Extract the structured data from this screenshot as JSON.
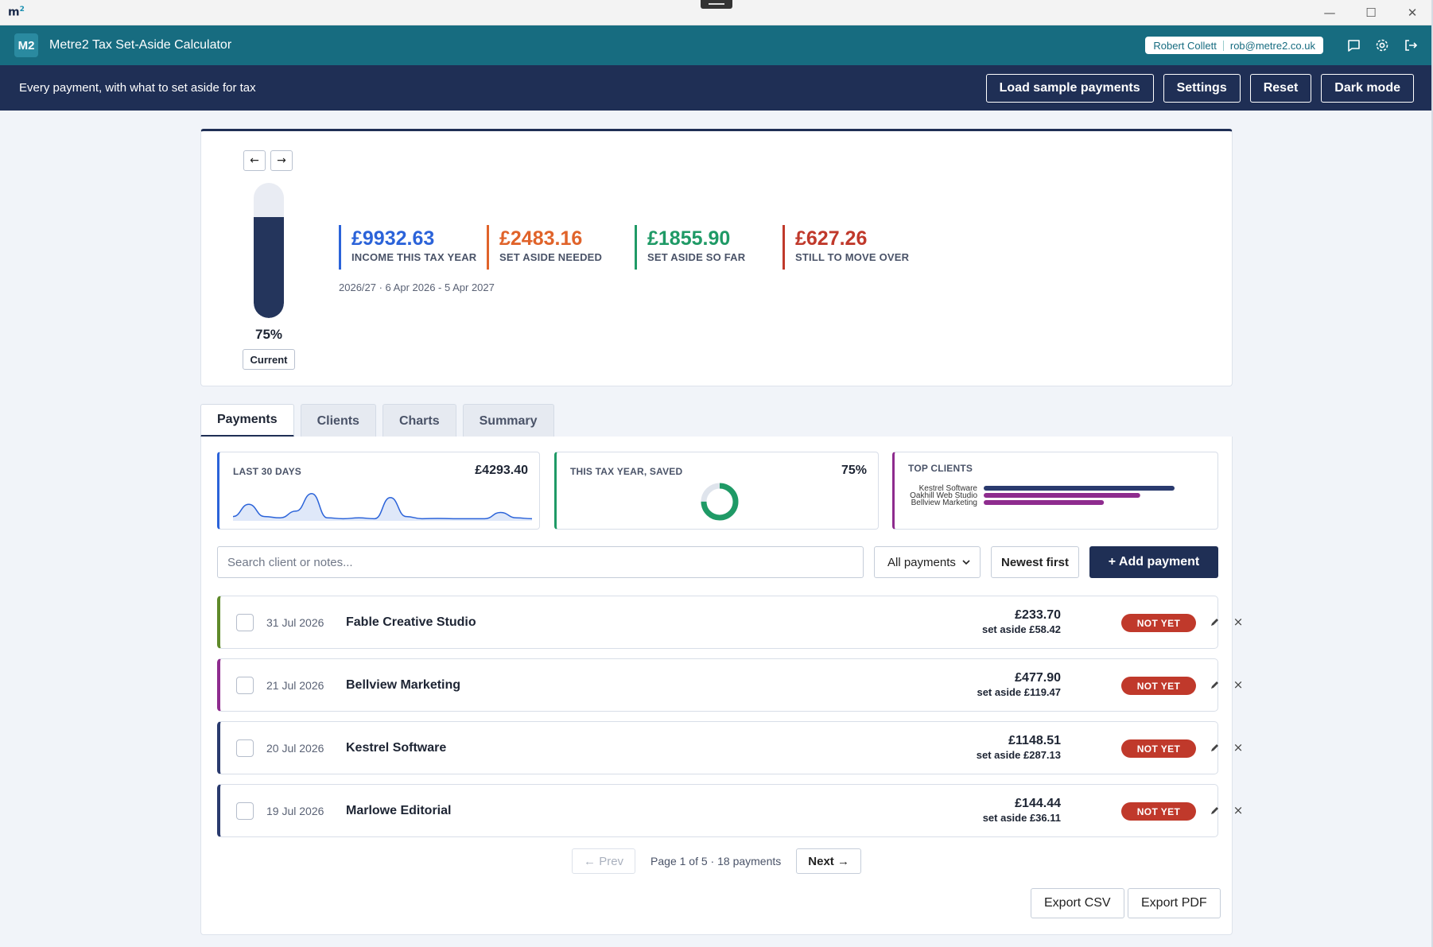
{
  "window": {
    "logo": "m",
    "logo_sup": "2"
  },
  "header": {
    "logo_text": "M2",
    "title": "Metre2 Tax Set-Aside Calculator",
    "user_name": "Robert Collett",
    "user_email": "rob@metre2.co.uk"
  },
  "subbar": {
    "tagline": "Every payment, with what to set aside for tax",
    "actions": [
      "Load sample payments",
      "Settings",
      "Reset",
      "Dark mode"
    ]
  },
  "hero": {
    "prev_arrow": "←",
    "next_arrow": "→",
    "gauge_fraction": 0.75,
    "gauge_pct": "75%",
    "gauge_label": "Current",
    "stats": [
      {
        "value": "£9932.63",
        "label": "INCOME THIS TAX YEAR",
        "color": "#2b63d9"
      },
      {
        "value": "£2483.16",
        "label": "SET ASIDE NEEDED",
        "color": "#e0632a"
      },
      {
        "value": "£1855.90",
        "label": "SET ASIDE SO FAR",
        "color": "#1f9a66"
      },
      {
        "value": "£627.26",
        "label": "STILL TO MOVE OVER",
        "color": "#c0392b"
      }
    ],
    "tax_year": "2026/27 · 6 Apr 2026 - 5 Apr 2027"
  },
  "tabs": [
    "Payments",
    "Clients",
    "Charts",
    "Summary"
  ],
  "cards": {
    "last30": {
      "title": "LAST 30 DAYS",
      "value": "£4293.40",
      "color": "#2b63d9",
      "series": [
        0.1,
        0.55,
        0.1,
        0.05,
        0.3,
        0.95,
        0.05,
        0.02,
        0.05,
        0.02,
        0.8,
        0.1,
        0.02,
        0.03,
        0.02,
        0.02,
        0.02,
        0.25,
        0.05,
        0.02
      ]
    },
    "saved": {
      "title": "THIS TAX YEAR, SAVED",
      "value": "75%",
      "fraction": 0.75,
      "color": "#1f9a66"
    },
    "top_clients": {
      "title": "TOP CLIENTS",
      "color": "#8e2c8e",
      "items": [
        {
          "name": "Kestrel Software",
          "share": 1.0,
          "color": "#2a3a6e"
        },
        {
          "name": "Oakhill Web Studio",
          "share": 0.82,
          "color": "#8e2c8e"
        },
        {
          "name": "Bellview Marketing",
          "share": 0.63,
          "color": "#8e2c8e"
        }
      ]
    }
  },
  "filters": {
    "search_placeholder": "Search client or notes...",
    "type_select": "All payments",
    "sort": "Newest first",
    "add": "+ Add payment"
  },
  "payments": [
    {
      "date": "31 Jul 2026",
      "client": "Fable Creative Studio",
      "amount": "£233.70",
      "set_aside": "set aside £58.42",
      "status": "NOT YET",
      "color": "#5f8a2a"
    },
    {
      "date": "21 Jul 2026",
      "client": "Bellview Marketing",
      "amount": "£477.90",
      "set_aside": "set aside £119.47",
      "status": "NOT YET",
      "color": "#8e2c8e"
    },
    {
      "date": "20 Jul 2026",
      "client": "Kestrel Software",
      "amount": "£1148.51",
      "set_aside": "set aside £287.13",
      "status": "NOT YET",
      "color": "#2a3a6e"
    },
    {
      "date": "19 Jul 2026",
      "client": "Marlowe Editorial",
      "amount": "£144.44",
      "set_aside": "set aside £36.11",
      "status": "NOT YET",
      "color": "#2a3a6e"
    }
  ],
  "pager": {
    "prev": "← Prev",
    "info": "Page 1 of 5 · 18 payments",
    "next": "Next →"
  },
  "exports": [
    "Export CSV",
    "Export PDF"
  ]
}
